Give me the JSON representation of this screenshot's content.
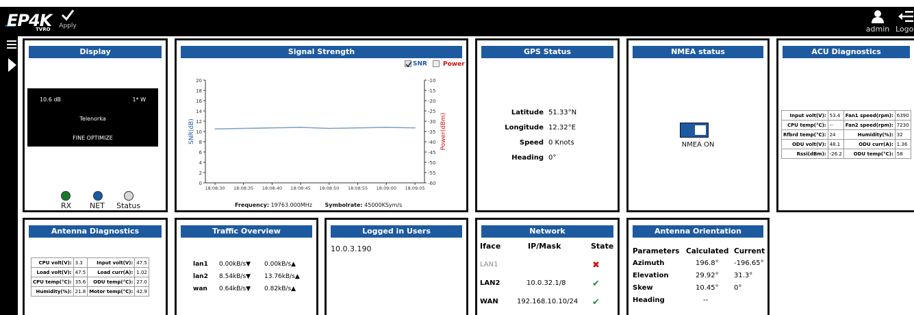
{
  "header": {
    "logo_text": "EP4K",
    "logo_sub": "TVRO",
    "apply_label": "Apply",
    "user_label": "admin",
    "logout_label": "Logo"
  },
  "display": {
    "title": "Display",
    "db": "10.6 dB",
    "power": "1* W",
    "satellite": "Telenorka",
    "mode": "FINE OPTIMIZE",
    "leds": [
      {
        "label": "RX",
        "color": "#1a7a2a"
      },
      {
        "label": "NET",
        "color": "#1e5aa0"
      },
      {
        "label": "Status",
        "color": "#d8d8d8"
      }
    ]
  },
  "signal": {
    "title": "Signal Strength",
    "snr_label": "SNR",
    "power_label": "Power",
    "snr_checked": true,
    "power_checked": false,
    "frequency_label": "Frequency:",
    "frequency_value": "19763.000MHz",
    "symbolrate_label": "Symbolrate:",
    "symbolrate_value": "45000KSym/s"
  },
  "chart_data": {
    "type": "line",
    "x": [
      "18:08:30",
      "18:08:35",
      "18:08:40",
      "18:08:45",
      "18:08:50",
      "18:08:55",
      "18:09:00",
      "18:09:05"
    ],
    "series": [
      {
        "name": "SNR",
        "values": [
          10.5,
          10.6,
          10.7,
          10.8,
          10.6,
          10.7,
          10.8,
          10.7
        ],
        "color": "#7aa0c8"
      }
    ],
    "ylabel": "SNR(dB)",
    "y2label": "Power(dBm)",
    "ylim": [
      0,
      20
    ],
    "yticks": [
      0,
      2,
      4,
      6,
      8,
      10,
      12,
      14,
      16,
      18,
      20
    ],
    "y2lim": [
      -60,
      -10
    ],
    "y2ticks": [
      -10,
      -15,
      -20,
      -25,
      -30,
      -35,
      -40,
      -45,
      -50,
      -55,
      -60
    ],
    "grid": false
  },
  "gps": {
    "title": "GPS Status",
    "rows": [
      {
        "k": "Latitude",
        "v": "51.33°N"
      },
      {
        "k": "Longitude",
        "v": "12.32°E"
      },
      {
        "k": "Speed",
        "v": "0 Knots"
      },
      {
        "k": "Heading",
        "v": "0°"
      }
    ]
  },
  "nmea": {
    "title": "NMEA status",
    "label": "NMEA ON",
    "on": true
  },
  "acu": {
    "title": "ACU Diagnostics",
    "rows": [
      [
        "Input volt(V):",
        "53.4",
        "Fan1 speed(rpm):",
        "6390"
      ],
      [
        "CPU temp(°C):",
        "--",
        "Fan2 speed(rpm):",
        "7230"
      ],
      [
        "Rfbrd temp(°C):",
        "24",
        "Humidity(%):",
        "32"
      ],
      [
        "ODU volt(V):",
        "48.1",
        "ODU curr(A):",
        "1.36"
      ],
      [
        "Rssi(dBm):",
        "-26.2",
        "ODU temp(°C):",
        "58"
      ]
    ]
  },
  "antenna_diag": {
    "title": "Antenna Diagnostics",
    "rows": [
      [
        "CPU volt(V):",
        "3.3",
        "Input volt(V):",
        "47.5"
      ],
      [
        "Load volt(V):",
        "47.5",
        "Load curr(A):",
        "1.02"
      ],
      [
        "CPU temp(°C):",
        "35.6",
        "ODU temp(°C):",
        "27.0"
      ],
      [
        "Humidity(%):",
        "21.8",
        "Motor temp(°C):",
        "42.9"
      ]
    ]
  },
  "traffic": {
    "title": "Traffic Overview",
    "rows": [
      {
        "iface": "lan1",
        "rx": "0.00kB/s▼",
        "tx": "0.00kB/s▲"
      },
      {
        "iface": "lan2",
        "rx": "8.54kB/s▼",
        "tx": "13.76kB/s▲"
      },
      {
        "iface": "wan",
        "rx": "0.64kB/s▼",
        "tx": "0.82kB/s▲"
      }
    ]
  },
  "logged": {
    "title": "Logged in Users",
    "users": [
      "10.0.3.190"
    ]
  },
  "network": {
    "title": "Network",
    "headers": [
      "Iface",
      "IP/Mask",
      "State"
    ],
    "rows": [
      {
        "iface": "LAN1",
        "ip": "",
        "state": "✖",
        "state_color": "#d01010",
        "dim": true
      },
      {
        "iface": "LAN2",
        "ip": "10.0.32.1/8",
        "state": "✔",
        "state_color": "#2a8a2a",
        "dim": false
      },
      {
        "iface": "WAN",
        "ip": "192.168.10.10/24",
        "state": "✔",
        "state_color": "#2a8a2a",
        "dim": false
      }
    ]
  },
  "orientation": {
    "title": "Antenna Orientation",
    "headers": [
      "Parameters",
      "Calculated",
      "Current"
    ],
    "rows": [
      [
        "Azimuth",
        "196.8°",
        "-196.65°"
      ],
      [
        "Elevation",
        "29.92°",
        "31.3°"
      ],
      [
        "Skew",
        "10.45°",
        "0°"
      ],
      [
        "Heading",
        "--",
        ""
      ]
    ]
  }
}
